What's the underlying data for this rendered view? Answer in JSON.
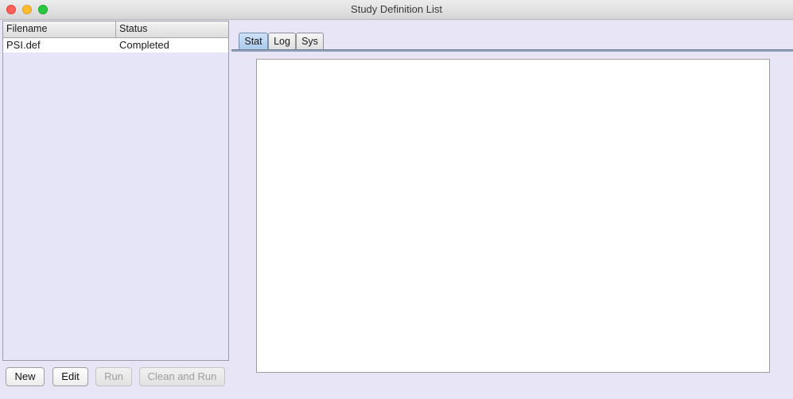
{
  "window": {
    "title": "Study Definition List"
  },
  "table": {
    "columns": [
      "Filename",
      "Status"
    ],
    "rows": [
      {
        "filename": "PSI.def",
        "status": "Completed"
      }
    ]
  },
  "buttons": {
    "new": "New",
    "edit": "Edit",
    "run": "Run",
    "clean_and_run": "Clean and Run"
  },
  "tabs": [
    "Stat",
    "Log",
    "Sys"
  ],
  "active_tab": "Stat",
  "colors": {
    "background": "#e8e6f6",
    "active_tab": "#a9c9ec",
    "close": "#fe5f57",
    "minimize": "#febc2e",
    "maximize": "#28c840"
  }
}
